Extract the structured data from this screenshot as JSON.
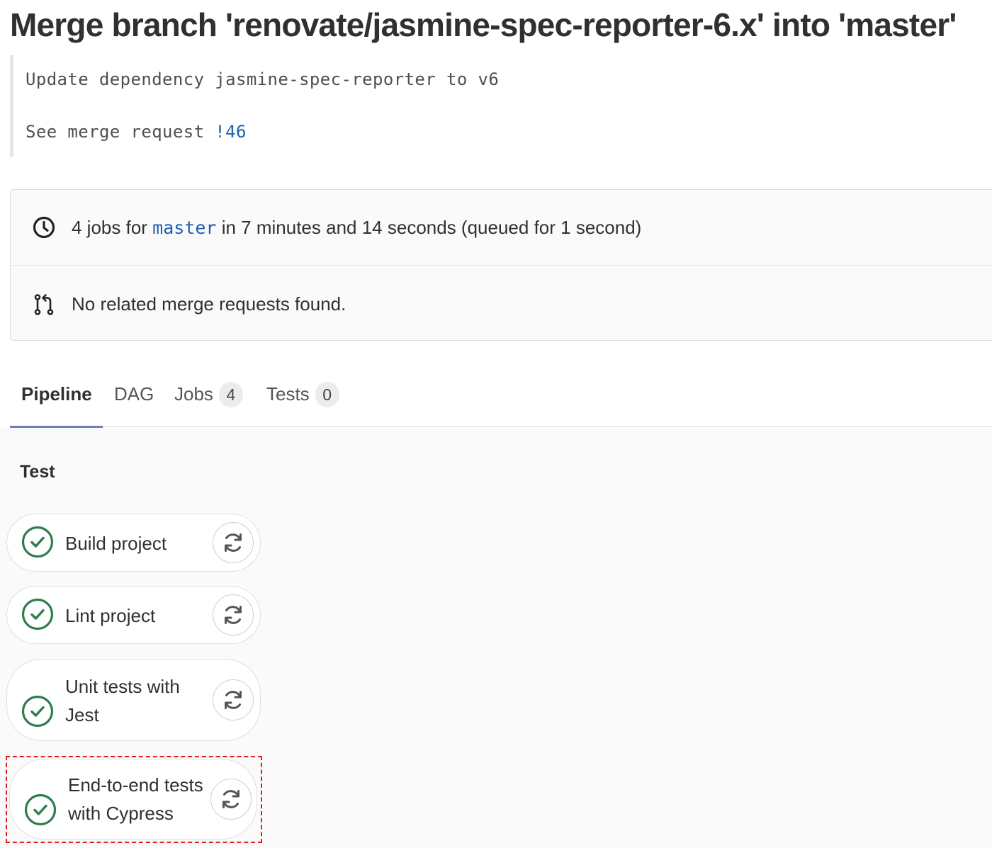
{
  "commit": {
    "title": "Merge branch 'renovate/jasmine-spec-reporter-6.x' into 'master'",
    "description_line1": "Update dependency jasmine-spec-reporter to v6",
    "description_line2_prefix": "See merge request ",
    "merge_request_link": "!46"
  },
  "pipeline_info": {
    "jobs_prefix": "4 jobs for ",
    "branch": "master",
    "jobs_suffix": " in 7 minutes and 14 seconds (queued for 1 second)",
    "related_mr_text": "No related merge requests found.",
    "clock_icon": "clock-icon",
    "merge_request_icon": "merge-request-icon"
  },
  "tabs": [
    {
      "label": "Pipeline",
      "active": true
    },
    {
      "label": "DAG"
    },
    {
      "label": "Jobs",
      "count": "4"
    },
    {
      "label": "Tests",
      "count": "0"
    }
  ],
  "stage": {
    "title": "Test",
    "jobs": [
      {
        "line1": "Build project",
        "line2": "",
        "status": "success"
      },
      {
        "line1": "Lint project",
        "line2": "",
        "status": "success"
      },
      {
        "line1": "Unit tests with",
        "line2": "Jest",
        "status": "success"
      },
      {
        "line1": "End-to-end tests",
        "line2": "with Cypress",
        "status": "success",
        "highlighted": true
      }
    ]
  },
  "colors": {
    "success_green": "#2f7d4f",
    "link_blue": "#1f5fb0",
    "tab_underline": "#6b7fb8",
    "highlight_red": "#e02020"
  }
}
